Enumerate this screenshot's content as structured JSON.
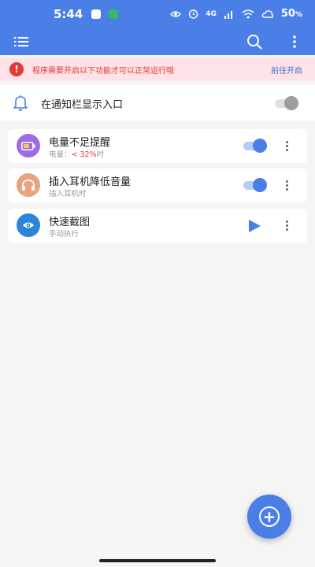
{
  "status_bar": {
    "time": "5:44",
    "network": "4G",
    "battery": "50"
  },
  "app_bar": {
    "menu_icon": "list-menu-icon",
    "search_icon": "search-icon",
    "more_icon": "more-vertical-icon"
  },
  "warning": {
    "icon": "!",
    "text": "程序需要开启以下功能才可以正常运行哦",
    "action": "前往开启"
  },
  "notification": {
    "label": "在通知栏显示入口",
    "enabled": false
  },
  "tasks": [
    {
      "title": "电量不足提醒",
      "sub_prefix": "电量：",
      "sub_value": "< 32%",
      "sub_suffix": "时",
      "icon": "battery-icon",
      "icon_color": "#9b6ce6",
      "enabled": true
    },
    {
      "title": "插入耳机降低音量",
      "sub": "插入耳机时",
      "icon": "headphones-icon",
      "icon_color": "#e9a37e",
      "enabled": true
    },
    {
      "title": "快速截图",
      "sub": "手动执行",
      "icon": "screenshot-icon",
      "icon_color": "#2e84d6",
      "action_icon": "play-icon"
    }
  ],
  "fab": {
    "icon": "+"
  },
  "colors": {
    "primary": "#4a7fe8",
    "warning_bg": "#fde3e7",
    "warning_text": "#e53935",
    "background": "#f5f5f5"
  }
}
